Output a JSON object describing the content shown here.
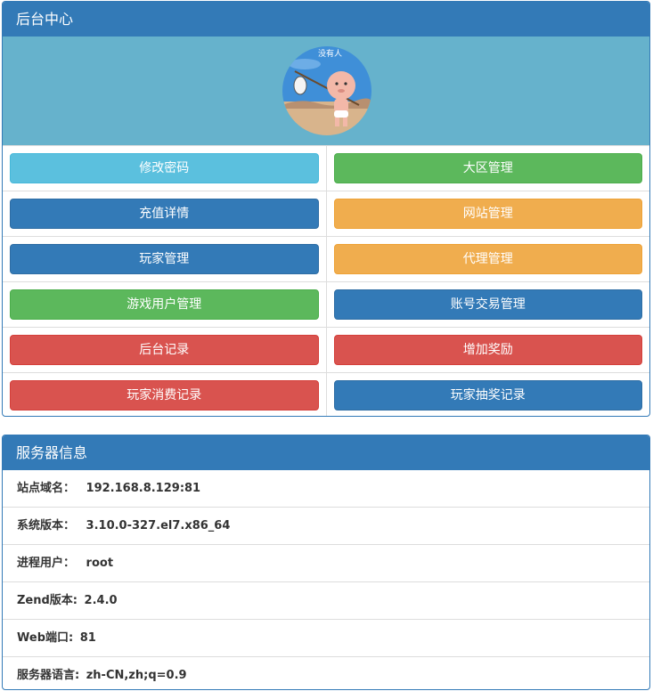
{
  "admin_panel": {
    "title": "后台中心",
    "avatar": {
      "icon": "cartoon-baby-traveler-avatar",
      "caption": "没有人"
    },
    "buttons": [
      {
        "label": "修改密码",
        "color": "#5bc0de"
      },
      {
        "label": "大区管理",
        "color": "#5cb85c"
      },
      {
        "label": "充值详情",
        "color": "#337ab7"
      },
      {
        "label": "网站管理",
        "color": "#f0ad4e"
      },
      {
        "label": "玩家管理",
        "color": "#337ab7"
      },
      {
        "label": "代理管理",
        "color": "#f0ad4e"
      },
      {
        "label": "游戏用户管理",
        "color": "#5cb85c"
      },
      {
        "label": "账号交易管理",
        "color": "#337ab7"
      },
      {
        "label": "后台记录",
        "color": "#d9534f"
      },
      {
        "label": "增加奖励",
        "color": "#d9534f"
      },
      {
        "label": "玩家消费记录",
        "color": "#d9534f"
      },
      {
        "label": "玩家抽奖记录",
        "color": "#337ab7"
      }
    ]
  },
  "server_panel": {
    "title": "服务器信息",
    "rows": [
      {
        "label": "站点域名：",
        "value": "192.168.8.129:81"
      },
      {
        "label": "系统版本：",
        "value": "3.10.0-327.el7.x86_64"
      },
      {
        "label": "进程用户：",
        "value": "root"
      },
      {
        "label": "Zend版本:",
        "value": "2.4.0"
      },
      {
        "label": "Web端口:",
        "value": "81"
      },
      {
        "label": "服务器语言:",
        "value": "zh-CN,zh;q=0.9"
      }
    ]
  },
  "colors": {
    "primary": "#337ab7",
    "info": "#5bc0de",
    "success": "#5cb85c",
    "warning": "#f0ad4e",
    "danger": "#d9534f",
    "banner": "#66b2cc"
  }
}
